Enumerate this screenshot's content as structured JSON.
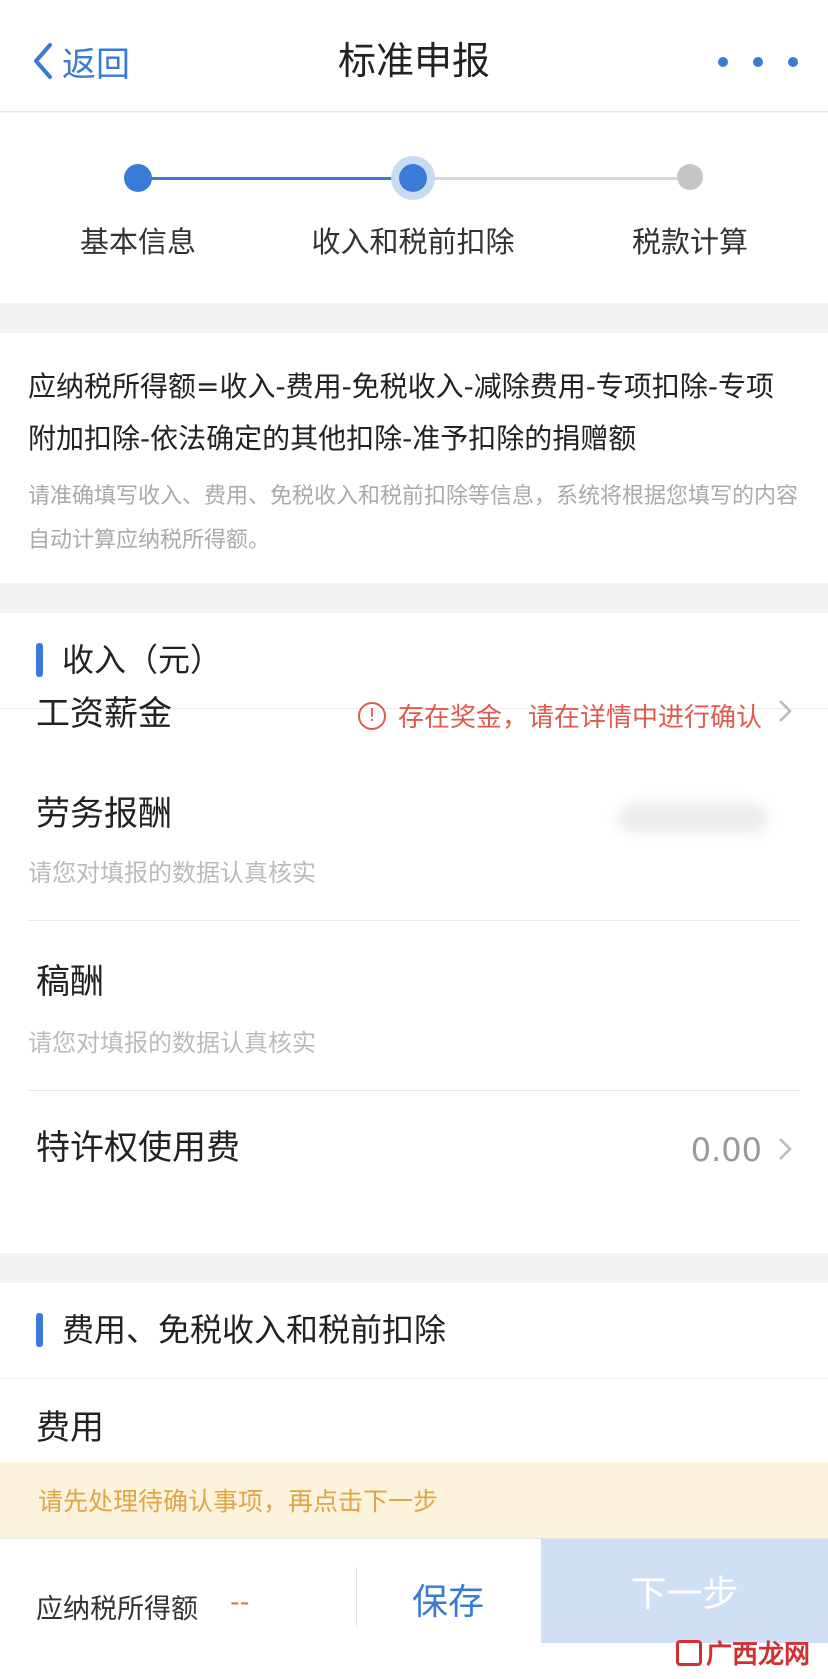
{
  "nav": {
    "back_label": "返回",
    "title": "标准申报"
  },
  "steps": [
    {
      "label": "基本信息",
      "state": "done"
    },
    {
      "label": "收入和税前扣除",
      "state": "current"
    },
    {
      "label": "税款计算",
      "state": "pending"
    }
  ],
  "formula": {
    "text": "应纳税所得额=收入-费用-免税收入-减除费用-专项扣除-专项附加扣除-依法确定的其他扣除-准予扣除的捐赠额",
    "hint": "请准确填写收入、费用、免税收入和税前扣除等信息，系统将根据您填写的内容自动计算应纳税所得额。"
  },
  "income": {
    "title": "收入（元）",
    "rows": [
      {
        "label": "工资薪金",
        "warning": "存在奖金，请在详情中进行确认"
      },
      {
        "label": "劳务报酬",
        "hint": "请您对填报的数据认真核实"
      },
      {
        "label": "稿酬",
        "hint": "请您对填报的数据认真核实"
      },
      {
        "label": "特许权使用费",
        "value": "0.00"
      }
    ]
  },
  "fees": {
    "title": "费用、免税收入和税前扣除",
    "rows": [
      {
        "label": "费用"
      }
    ]
  },
  "toast": "请先处理待确认事项，再点击下一步",
  "bottom": {
    "tax_label": "应纳税所得额",
    "tax_value": "--",
    "save_label": "保存",
    "next_label": "下一步"
  },
  "watermark": "广西龙网",
  "colors": {
    "accent": "#3a7bd5",
    "warning": "#e05a4f",
    "toast_text": "#e0a545",
    "toast_bg": "#fdf3dc",
    "next_disabled": "#cfe0f5"
  }
}
